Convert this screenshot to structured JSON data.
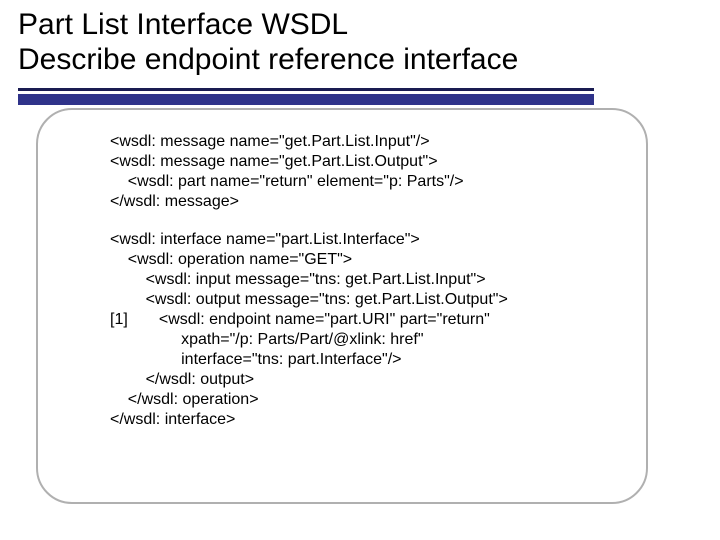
{
  "title_line1": "Part List Interface WSDL",
  "title_line2": "Describe endpoint reference interface",
  "code_block1": "<wsdl: message name=\"get.Part.List.Input\"/>\n<wsdl: message name=\"get.Part.List.Output\">\n    <wsdl: part name=\"return\" element=\"p: Parts\"/>\n</wsdl: message>",
  "code_block2": "<wsdl: interface name=\"part.List.Interface\">\n    <wsdl: operation name=\"GET\">\n        <wsdl: input message=\"tns: get.Part.List.Input\">\n        <wsdl: output message=\"tns: get.Part.List.Output\">\n[1]       <wsdl: endpoint name=\"part.URI\" part=\"return\"\n                xpath=\"/p: Parts/Part/@xlink: href\"\n                interface=\"tns: part.Interface\"/>\n        </wsdl: output>\n    </wsdl: operation>\n</wsdl: interface>"
}
